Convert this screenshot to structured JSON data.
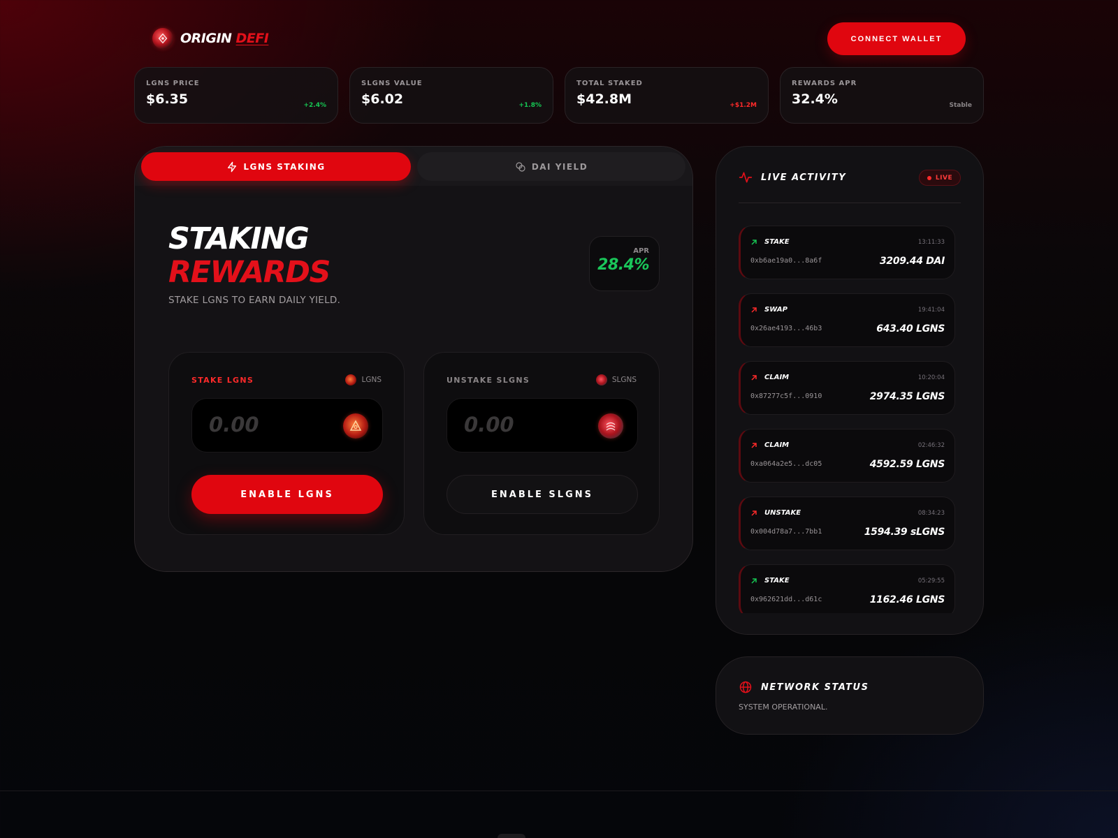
{
  "brand": {
    "name_1": "ORIGIN",
    "name_2": "DEFI"
  },
  "header": {
    "connect_label": "CONNECT WALLET"
  },
  "stats": [
    {
      "label": "LGNS PRICE",
      "value": "$6.35",
      "change": "+2.4%"
    },
    {
      "label": "SLGNS VALUE",
      "value": "$6.02",
      "change": "+1.8%"
    },
    {
      "label": "TOTAL STAKED",
      "value": "$42.8M",
      "change": "+$1.2M"
    },
    {
      "label": "REWARDS APR",
      "value": "32.4%",
      "change": "Stable"
    }
  ],
  "tabs": [
    {
      "label": "LGNS STAKING",
      "icon": "lightning-icon",
      "active": true
    },
    {
      "label": "DAI YIELD",
      "icon": "coins-icon",
      "active": false
    }
  ],
  "main": {
    "title_line1": "STAKING",
    "title_line2": "REWARDS",
    "subtitle": "STAKE LGNS TO EARN DAILY YIELD.",
    "apr_label": "APR",
    "apr_value": "28.4%"
  },
  "stake_card": {
    "label": "STAKE LGNS",
    "token": "LGNS",
    "placeholder": "0.00",
    "button": "ENABLE LGNS"
  },
  "unstake_card": {
    "label": "UNSTAKE SLGNS",
    "token": "SLGNS",
    "placeholder": "0.00",
    "button": "ENABLE SLGNS"
  },
  "activity": {
    "title": "LIVE ACTIVITY",
    "live_label": "LIVE",
    "items": [
      {
        "type": "STAKE",
        "direction": "up",
        "time": "13:11:33",
        "address": "0xb6ae19a0...8a6f",
        "amount": "3209.44 DAI"
      },
      {
        "type": "SWAP",
        "direction": "up-red",
        "time": "19:41:04",
        "address": "0x26ae4193...46b3",
        "amount": "643.40 LGNS"
      },
      {
        "type": "CLAIM",
        "direction": "up-red",
        "time": "10:20:04",
        "address": "0x87277c5f...0910",
        "amount": "2974.35 LGNS"
      },
      {
        "type": "CLAIM",
        "direction": "up-red",
        "time": "02:46:32",
        "address": "0xa064a2e5...dc05",
        "amount": "4592.59 LGNS"
      },
      {
        "type": "UNSTAKE",
        "direction": "up-red",
        "time": "08:34:23",
        "address": "0x004d78a7...7bb1",
        "amount": "1594.39 sLGNS"
      },
      {
        "type": "STAKE",
        "direction": "up",
        "time": "05:29:55",
        "address": "0x962621dd...d61c",
        "amount": "1162.46 LGNS"
      }
    ]
  },
  "network": {
    "title": "NETWORK STATUS",
    "status": "SYSTEM OPERATIONAL."
  },
  "colors": {
    "accent": "#e0060f",
    "positive": "#16c653",
    "negative": "#ff2a2a"
  }
}
